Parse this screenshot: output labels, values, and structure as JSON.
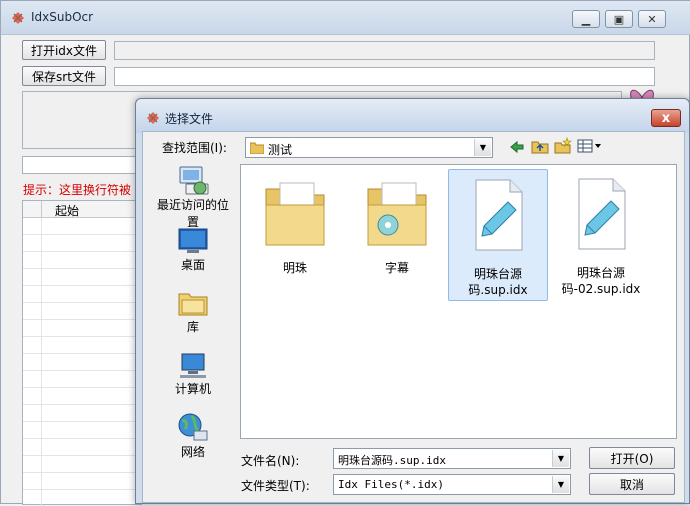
{
  "main": {
    "title": "IdxSubOcr",
    "open_button": "打开idx文件",
    "save_button": "保存srt文件",
    "hint": "提示：这里换行符被",
    "table_header": "起始"
  },
  "dialog": {
    "title": "选择文件",
    "lookin_label": "查找范围(I):",
    "lookin_value": "测试",
    "places": [
      {
        "label": "最近访问的位置",
        "icon": "recent-places-icon"
      },
      {
        "label": "桌面",
        "icon": "desktop-icon"
      },
      {
        "label": "库",
        "icon": "libraries-icon"
      },
      {
        "label": "计算机",
        "icon": "computer-icon"
      },
      {
        "label": "网络",
        "icon": "network-icon"
      }
    ],
    "files": [
      {
        "label": "明珠",
        "icon": "folder-icon"
      },
      {
        "label": "字幕",
        "icon": "folder-media-icon"
      },
      {
        "label": "明珠台源码.sup.idx",
        "icon": "notepad-file-icon"
      },
      {
        "label": "明珠台源码-02.sup.idx",
        "icon": "notepad-file-icon"
      }
    ],
    "filename_label": "文件名(N):",
    "filename_value": "明珠台源码.sup.idx",
    "filetype_label": "文件类型(T):",
    "filetype_value": "Idx Files(*.idx)",
    "open_label": "打开(O)",
    "cancel_label": "取消",
    "close_label": "x"
  },
  "colors": {
    "hint_red": "#d40000",
    "selection": "#dcebfc"
  }
}
